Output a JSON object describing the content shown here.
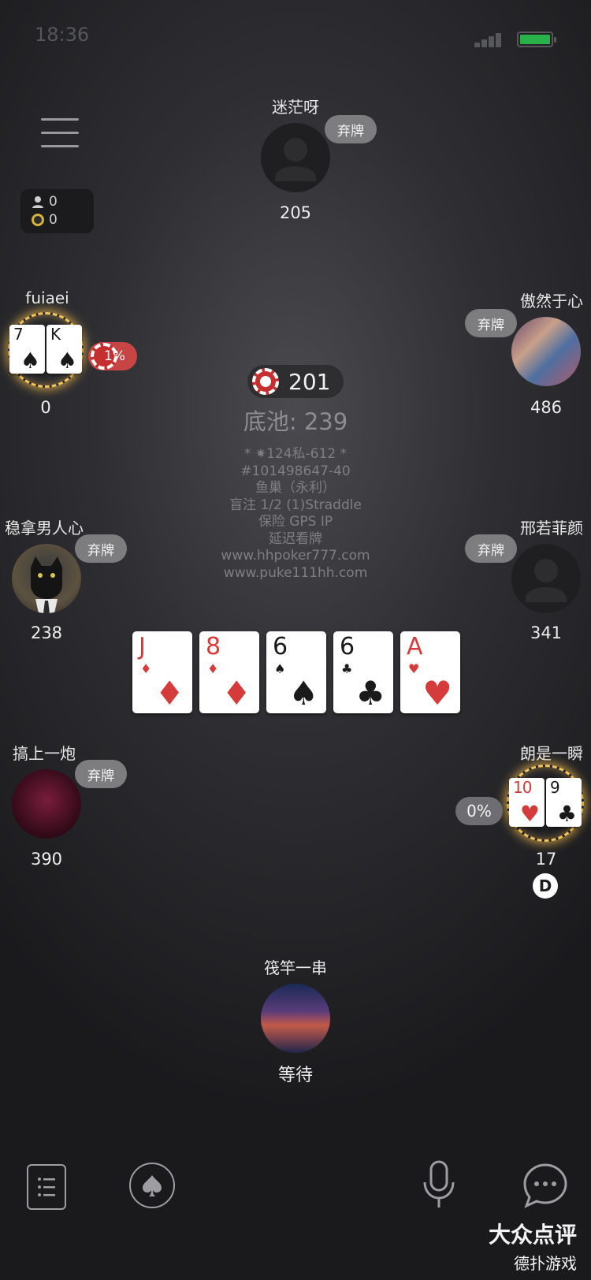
{
  "status_bar": {
    "time": "18:36"
  },
  "counters": {
    "players": "0",
    "coins": "0"
  },
  "players": {
    "top": {
      "name": "迷茫呀",
      "chips": "205",
      "action": "弃牌"
    },
    "upper_left": {
      "name": "fuiaei",
      "chips": "0",
      "hand": [
        {
          "rank": "7",
          "suit": "♠",
          "color": "black"
        },
        {
          "rank": "K",
          "suit": "♠",
          "color": "black"
        }
      ],
      "equity": "1%"
    },
    "upper_right": {
      "name": "傲然于心",
      "chips": "486",
      "action": "弃牌"
    },
    "mid_left": {
      "name": "稳拿男人心",
      "chips": "238",
      "action": "弃牌"
    },
    "mid_right": {
      "name": "邢若菲颜",
      "chips": "341",
      "action": "弃牌"
    },
    "lower_left": {
      "name": "搞上一炮",
      "chips": "390",
      "action": "弃牌"
    },
    "lower_right": {
      "name": "朗是一瞬",
      "chips": "17",
      "hand": [
        {
          "rank": "10",
          "suit": "♥",
          "color": "red"
        },
        {
          "rank": "9",
          "suit": "♣",
          "color": "black"
        }
      ],
      "equity": "0%",
      "dealer_label": "D"
    },
    "self": {
      "name": "筏竿一串",
      "status": "等待"
    }
  },
  "pot": {
    "current": "201",
    "total_label": "底池: 239"
  },
  "table_info": [
    "* ✷124私-612 *",
    "#101498647-40",
    "鱼巢（永利）",
    "盲注 1/2 (1)Straddle",
    "保险 GPS IP",
    "延迟看牌",
    "www.hhpoker777.com",
    "www.puke111hh.com"
  ],
  "community_cards": [
    {
      "rank": "J",
      "suit": "♦",
      "color": "red"
    },
    {
      "rank": "8",
      "suit": "♦",
      "color": "red"
    },
    {
      "rank": "6",
      "suit": "♠",
      "color": "black"
    },
    {
      "rank": "6",
      "suit": "♣",
      "color": "black"
    },
    {
      "rank": "A",
      "suit": "♥",
      "color": "red"
    }
  ],
  "bottom_bar": {
    "icons": [
      "history-icon",
      "spade-emoji-icon",
      "microphone-icon",
      "chat-icon"
    ]
  },
  "watermark": {
    "brand": "大众点评",
    "subtitle": "德扑游戏"
  },
  "colors": {
    "red_suit": "#d53b3b",
    "fold_badge": "#7d7d80",
    "glow": "#f3c35c",
    "battery": "#29b24a"
  }
}
